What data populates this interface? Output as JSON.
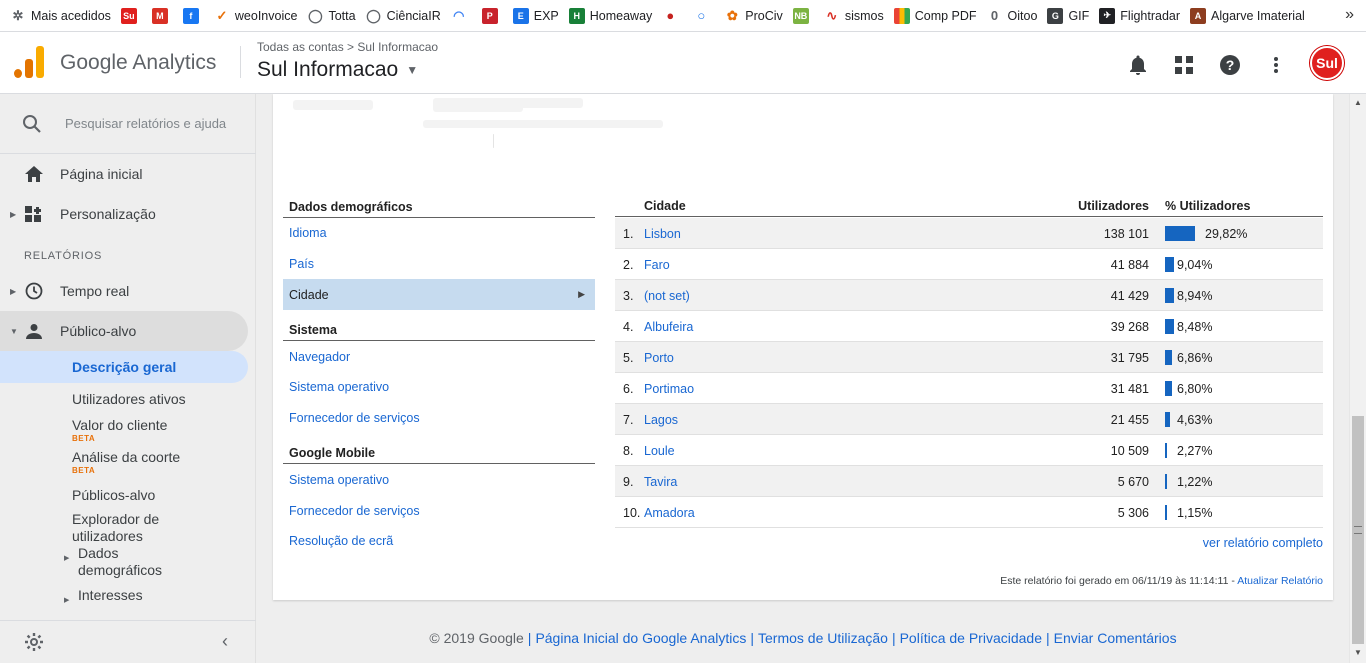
{
  "bookmarks": [
    {
      "label": "Mais acedidos",
      "icon": "gear-icon",
      "color": "#5f6368"
    },
    {
      "label": "",
      "icon": "sul-informacao-icon",
      "color": "#e0201e"
    },
    {
      "label": "",
      "icon": "gmail-icon",
      "color": "#d93025"
    },
    {
      "label": "",
      "icon": "facebook-icon",
      "color": "#1877f2"
    },
    {
      "label": "weoInvoice",
      "icon": "weoinvoice-icon",
      "color": "#e8710a"
    },
    {
      "label": "Totta",
      "icon": "globe-icon",
      "color": "#5f6368"
    },
    {
      "label": "CiênciaIR",
      "icon": "globe-icon",
      "color": "#5f6368"
    },
    {
      "label": "",
      "icon": "rainbow-icon",
      "color": "#4285f4"
    },
    {
      "label": "",
      "icon": "pinterest-icon",
      "color": "#c8232c"
    },
    {
      "label": "EXP",
      "icon": "exp-icon",
      "color": "#1a73e8"
    },
    {
      "label": "Homeaway",
      "icon": "homeaway-icon",
      "color": "#188038"
    },
    {
      "label": "",
      "icon": "red-circle-icon",
      "color": "#c5221f"
    },
    {
      "label": "",
      "icon": "ring-icon",
      "color": "#1a73e8"
    },
    {
      "label": "ProCiv",
      "icon": "prociv-icon",
      "color": "#e8710a"
    },
    {
      "label": "",
      "icon": "nb-icon",
      "color": "#7cb342"
    },
    {
      "label": "sismos",
      "icon": "pulse-icon",
      "color": "#d93025"
    },
    {
      "label": "Comp PDF",
      "icon": "pdf-icon",
      "color": "#f9ab00"
    },
    {
      "label": "Oitoo",
      "icon": "oitoo-icon",
      "color": "#5f6368"
    },
    {
      "label": "GIF",
      "icon": "gif-icon",
      "color": "#3c4043"
    },
    {
      "label": "Flightradar",
      "icon": "flightradar-icon",
      "color": "#202124"
    },
    {
      "label": "Algarve Imaterial",
      "icon": "algarve-icon",
      "color": "#8d3d1f"
    }
  ],
  "header": {
    "app_title": "Google Analytics",
    "breadcrumb": "Todas as contas > Sul Informacao",
    "property": "Sul Informacao",
    "avatar_text": "Sul"
  },
  "sidebar": {
    "search_placeholder": "Pesquisar relatórios e ajuda",
    "home": "Página inicial",
    "custom": "Personalização",
    "reports_section": "RELATÓRIOS",
    "realtime": "Tempo real",
    "audience": "Público-alvo",
    "sub": {
      "overview": "Descrição geral",
      "active_users": "Utilizadores ativos",
      "lifetime_value": "Valor do cliente",
      "cohort": "Análise da coorte",
      "beta": "BETA",
      "audiences": "Públicos-alvo",
      "user_explorer": "Explorador de utilizadores",
      "demographics": "Dados demográficos",
      "interests": "Interesses"
    }
  },
  "left_list": {
    "demographics_head": "Dados demográficos",
    "language": "Idioma",
    "country": "País",
    "city": "Cidade",
    "system_head": "Sistema",
    "browser": "Navegador",
    "os": "Sistema operativo",
    "isp": "Fornecedor de serviços",
    "mobile_head": "Google Mobile",
    "mobile_os": "Sistema operativo",
    "mobile_isp": "Fornecedor de serviços",
    "resolution": "Resolução de ecrã"
  },
  "table": {
    "col_city": "Cidade",
    "col_users": "Utilizadores",
    "col_pct": "% Utilizadores",
    "rows": [
      {
        "rank": "1.",
        "city": "Lisbon",
        "users": "138 101",
        "pct": "29,82%",
        "value": 29.82
      },
      {
        "rank": "2.",
        "city": "Faro",
        "users": "41 884",
        "pct": "9,04%",
        "value": 9.04
      },
      {
        "rank": "3.",
        "city": "(not set)",
        "users": "41 429",
        "pct": "8,94%",
        "value": 8.94
      },
      {
        "rank": "4.",
        "city": "Albufeira",
        "users": "39 268",
        "pct": "8,48%",
        "value": 8.48
      },
      {
        "rank": "5.",
        "city": "Porto",
        "users": "31 795",
        "pct": "6,86%",
        "value": 6.86
      },
      {
        "rank": "6.",
        "city": "Portimao",
        "users": "31 481",
        "pct": "6,80%",
        "value": 6.8
      },
      {
        "rank": "7.",
        "city": "Lagos",
        "users": "21 455",
        "pct": "4,63%",
        "value": 4.63
      },
      {
        "rank": "8.",
        "city": "Loule",
        "users": "10 509",
        "pct": "2,27%",
        "value": 2.27
      },
      {
        "rank": "9.",
        "city": "Tavira",
        "users": "5 670",
        "pct": "1,22%",
        "value": 1.22
      },
      {
        "rank": "10.",
        "city": "Amadora",
        "users": "5 306",
        "pct": "1,15%",
        "value": 1.15
      }
    ],
    "full_report": "ver relatório completo",
    "generated": "Este relatório foi gerado em 06/11/19 às 11:14:11 - ",
    "refresh": "Atualizar Relatório"
  },
  "footer": {
    "copyright": "© 2019 Google",
    "home_link": "Página Inicial do Google Analytics",
    "terms": "Termos de Utilização",
    "privacy": "Política de Privacidade",
    "feedback": "Enviar Comentários"
  },
  "colors": {
    "accent": "#1967d2",
    "bar": "#1565c0",
    "selected_row": "#c6dbef"
  }
}
